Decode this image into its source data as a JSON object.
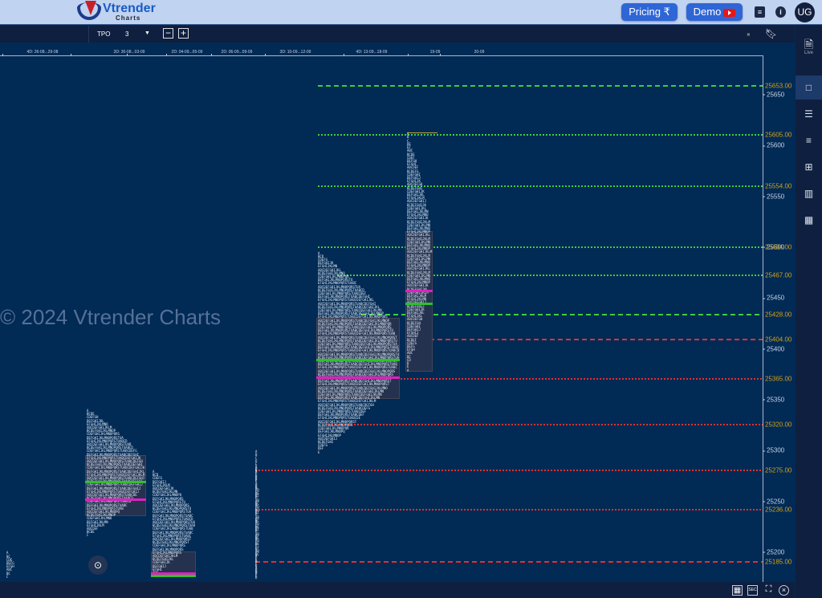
{
  "header": {
    "logo_text": "Vtrender",
    "logo_sub": "Charts",
    "pricing_label": "Pricing ₹",
    "demo_label": "Demo",
    "avatar": "UG",
    "icons": [
      "notes-icon",
      "info-icon"
    ]
  },
  "toolbar": {
    "mode": "TPO",
    "value": "3",
    "icons": [
      "minus-icon",
      "plus-icon",
      "save-icon",
      "bookmark-icon"
    ]
  },
  "date_labels": [
    "4D: 26-08...29-08",
    "3D: 30-08...03-09",
    "2D: 04-09...05-09",
    "2D: 06-09...09-09",
    "3D: 10-09...12-09",
    "4D: 13-09...18-09",
    "19-09",
    "20-09"
  ],
  "watermark": "© 2024 Vtrender Charts",
  "price_axis": {
    "ticks": [
      "25650",
      "25600",
      "25550",
      "25500",
      "25450",
      "25400",
      "25350",
      "25300",
      "25250",
      "25200"
    ]
  },
  "levels": [
    {
      "price": "25653.00",
      "color": "#3ccf3c",
      "style": "dashed"
    },
    {
      "price": "25605.00",
      "color": "#3ccf3c",
      "style": "dotted"
    },
    {
      "price": "25554.00",
      "color": "#3ccf3c",
      "style": "dotted"
    },
    {
      "price": "25494.00",
      "color": "#3ccf3c",
      "style": "dotted"
    },
    {
      "price": "25467.00",
      "color": "#3ccf3c",
      "style": "dotted"
    },
    {
      "price": "25428.00",
      "color": "#3ccf3c",
      "style": "dashed"
    },
    {
      "price": "25404.00",
      "color": "#e03030",
      "style": "dashed"
    },
    {
      "price": "25365.00",
      "color": "#e03030",
      "style": "dotted"
    },
    {
      "price": "25320.00",
      "color": "#e03030",
      "style": "dotted"
    },
    {
      "price": "25275.00",
      "color": "#e03030",
      "style": "dotted"
    },
    {
      "price": "25236.00",
      "color": "#e03030",
      "style": "dotted"
    },
    {
      "price": "25185.00",
      "color": "#e03030",
      "style": "dashed"
    }
  ],
  "profiles": [
    {
      "high": 25195,
      "low": 25168,
      "va_high": null,
      "va_low": null,
      "poc": null
    },
    {
      "high": 25335,
      "low": 25210,
      "va_high": 25290,
      "va_low": 25230,
      "poc": 25265
    },
    {
      "high": 25275,
      "low": 25168,
      "va_high": 25195,
      "va_low": 25170,
      "poc": 25172
    },
    {
      "high": 25280,
      "low": 25168,
      "va_high": null,
      "va_low": null,
      "poc": null
    },
    {
      "high": 25295,
      "low": 25168,
      "va_high": null,
      "va_low": null,
      "poc": null
    },
    {
      "high": 25490,
      "low": 25290,
      "va_high": 25425,
      "va_low": 25345,
      "poc": 25385
    },
    {
      "high": 25607,
      "low": 25372,
      "va_high": 25510,
      "va_low": 25372,
      "poc": 25440
    },
    {
      "high": 25607,
      "low": 25607,
      "va_high": null,
      "va_low": null,
      "poc": null
    }
  ],
  "colors": {
    "background": "#012a55",
    "poc": "#2ec02e",
    "vwap": "#e020c0",
    "level_label": "#d4a017"
  },
  "sidebar": {
    "live_label": "Live",
    "icons": [
      "live-doc-icon",
      "single-layout-icon",
      "split-layout-icon",
      "rows-layout-icon",
      "grid-layout-icon",
      "columns-layout-icon",
      "grid-6-layout-icon"
    ]
  },
  "bottom": {
    "sec_label": "SEC",
    "icons": [
      "grid-icon",
      "sec-icon",
      "focus-icon",
      "close-icon"
    ]
  }
}
